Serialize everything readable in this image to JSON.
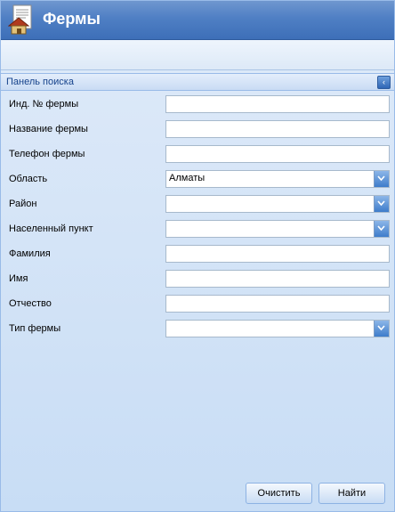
{
  "window": {
    "title": "Фермы",
    "icon": "farm-house-document-icon"
  },
  "panel": {
    "title": "Панель поиска",
    "collapse_icon": "chevron-left-icon"
  },
  "form": {
    "fields": [
      {
        "label": "Инд. № фермы",
        "type": "text",
        "value": ""
      },
      {
        "label": "Название фермы",
        "type": "text",
        "value": ""
      },
      {
        "label": "Телефон фермы",
        "type": "text",
        "value": ""
      },
      {
        "label": "Область",
        "type": "select",
        "value": "Алматы"
      },
      {
        "label": "Район",
        "type": "select",
        "value": ""
      },
      {
        "label": "Населенный пункт",
        "type": "select",
        "value": ""
      },
      {
        "label": "Фамилия",
        "type": "text",
        "value": ""
      },
      {
        "label": "Имя",
        "type": "text",
        "value": ""
      },
      {
        "label": "Отчество",
        "type": "text",
        "value": ""
      },
      {
        "label": "Тип фермы",
        "type": "select",
        "value": ""
      }
    ]
  },
  "buttons": {
    "clear": "Очистить",
    "find": "Найти"
  },
  "colors": {
    "header": "#4f7fc4",
    "panel_title": "#15428b",
    "background": "#dce9f8"
  }
}
